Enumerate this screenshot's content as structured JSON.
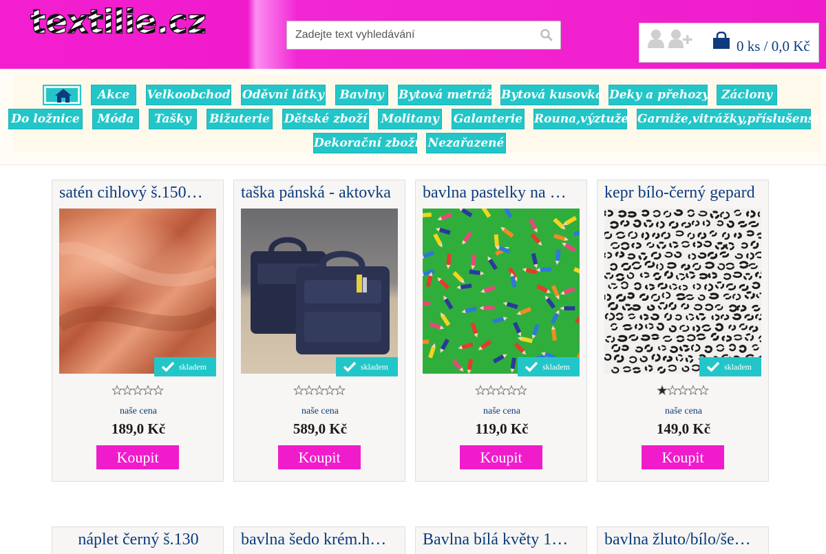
{
  "header": {
    "logo_text": "textilie.cz",
    "search": {
      "placeholder": "Zadejte text vyhledávání"
    },
    "icons": [
      "user-icon",
      "add-user-icon",
      "shopping-bag-icon",
      "search-icon"
    ],
    "cart_summary": "0 ks / 0,0 Kč"
  },
  "nav": {
    "home_icon": "home-icon",
    "items": [
      "Akce",
      "Velkoobchod",
      "Oděvní látky",
      "Bavlny",
      "Bytová metráž",
      "Bytová kusovka",
      "Deky a přehozy",
      "Záclony",
      "Do ložnice",
      "Móda",
      "Tašky",
      "Bižuterie",
      "Dětské zboží",
      "Molitany",
      "Galanterie",
      "Rouna,výztuže",
      "Garniže,vitrážky,příslušenství",
      "Dekorační zboží",
      "Nezařazené"
    ]
  },
  "products": [
    {
      "title": "satén cihlový š.150…",
      "stock": "skladem",
      "price_label": "naše cena",
      "price": "189,0 Kč",
      "rating": 0,
      "buy": "Koupit"
    },
    {
      "title": "taška pánská - aktovka",
      "stock": "skladem",
      "price_label": "naše cena",
      "price": "589,0 Kč",
      "rating": 0,
      "buy": "Koupit"
    },
    {
      "title": "bavlna pastelky na …",
      "stock": "skladem",
      "price_label": "naše cena",
      "price": "119,0 Kč",
      "rating": 0,
      "buy": "Koupit"
    },
    {
      "title": "kepr bílo-černý gepard",
      "stock": "skladem",
      "price_label": "naše cena",
      "price": "149,0 Kč",
      "rating": 1,
      "buy": "Koupit"
    }
  ],
  "products_row2": [
    {
      "title": "náplet černý š.130"
    },
    {
      "title": "bavlna šedo krém.h…"
    },
    {
      "title": "Bavlna bílá květy 1…"
    },
    {
      "title": "bavlna žluto/bílo/še…"
    }
  ],
  "colors": {
    "brand_pink": "#f01ccc",
    "nav_teal": "#23c6c8",
    "text_navy": "#0d3b7e"
  }
}
